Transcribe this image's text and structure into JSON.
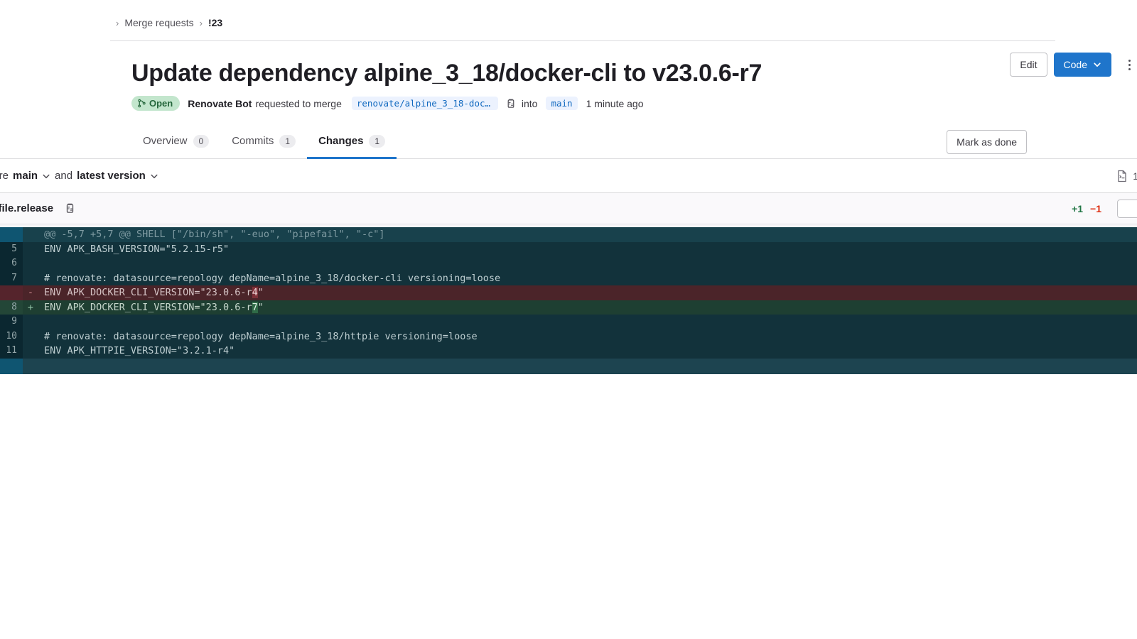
{
  "breadcrumb": {
    "separator": "›",
    "items": [
      {
        "label": "Merge requests",
        "current": false
      },
      {
        "label": "!23",
        "current": true
      }
    ]
  },
  "header": {
    "title": "Update dependency alpine_3_18/docker-cli to v23.0.6-r7",
    "status_badge": "Open",
    "author": "Renovate Bot",
    "action_text": "requested to merge",
    "source_branch": "renovate/alpine_3_18-docke…",
    "into_text": "into",
    "target_branch": "main",
    "timestamp": "1 minute ago",
    "edit_label": "Edit",
    "code_label": "Code",
    "more_actions_label": "More actions"
  },
  "tabs": [
    {
      "label": "Overview",
      "count": "0",
      "active": false
    },
    {
      "label": "Commits",
      "count": "1",
      "active": false
    },
    {
      "label": "Changes",
      "count": "1",
      "active": true
    }
  ],
  "mark_as_done_label": "Mark as done",
  "compare": {
    "prefix_label": "pare",
    "source_ref": "main",
    "and_label": "and",
    "target_ref": "latest version",
    "files_count": "1"
  },
  "file": {
    "name": "kerfile.release",
    "additions": "+1",
    "deletions": "−1"
  },
  "colors": {
    "accent_blue": "#1f75cb",
    "badge_open_bg": "#c3e6cd",
    "badge_open_fg": "#24663b",
    "addition_green": "#217645",
    "deletion_red": "#dd2b0e",
    "diff_bg": "#12323b"
  },
  "diff_lines": [
    {
      "type": "hunk",
      "ln": "",
      "sign": "",
      "code": "@@ -5,7 +5,7 @@ SHELL [\"/bin/sh\", \"-euo\", \"pipefail\", \"-c\"]"
    },
    {
      "type": "ctx",
      "ln": "5",
      "sign": "",
      "code": "ENV APK_BASH_VERSION=\"5.2.15-r5\""
    },
    {
      "type": "ctx",
      "ln": "6",
      "sign": "",
      "code": ""
    },
    {
      "type": "ctx",
      "ln": "7",
      "sign": "",
      "code": "# renovate: datasource=repology depName=alpine_3_18/docker-cli versioning=loose"
    },
    {
      "type": "del",
      "ln": "",
      "sign": "-",
      "code_pre": "ENV APK_DOCKER_CLI_VERSION=\"23.0.6-r",
      "code_hl": "4",
      "code_post": "\""
    },
    {
      "type": "add",
      "ln": "8",
      "sign": "+",
      "code_pre": "ENV APK_DOCKER_CLI_VERSION=\"23.0.6-r",
      "code_hl": "7",
      "code_post": "\""
    },
    {
      "type": "ctx",
      "ln": "9",
      "sign": "",
      "code": ""
    },
    {
      "type": "ctx",
      "ln": "10",
      "sign": "",
      "code": "# renovate: datasource=repology depName=alpine_3_18/httpie versioning=loose"
    },
    {
      "type": "ctx",
      "ln": "11",
      "sign": "",
      "code": "ENV APK_HTTPIE_VERSION=\"3.2.1-r4\""
    },
    {
      "type": "end",
      "ln": "",
      "sign": "",
      "code": ""
    }
  ],
  "icons": {
    "merge_request": "merge-request-icon",
    "copy": "copy-icon",
    "chevron_down": "chevron-down-icon",
    "kebab": "kebab-menu-icon",
    "file": "file-icon"
  }
}
